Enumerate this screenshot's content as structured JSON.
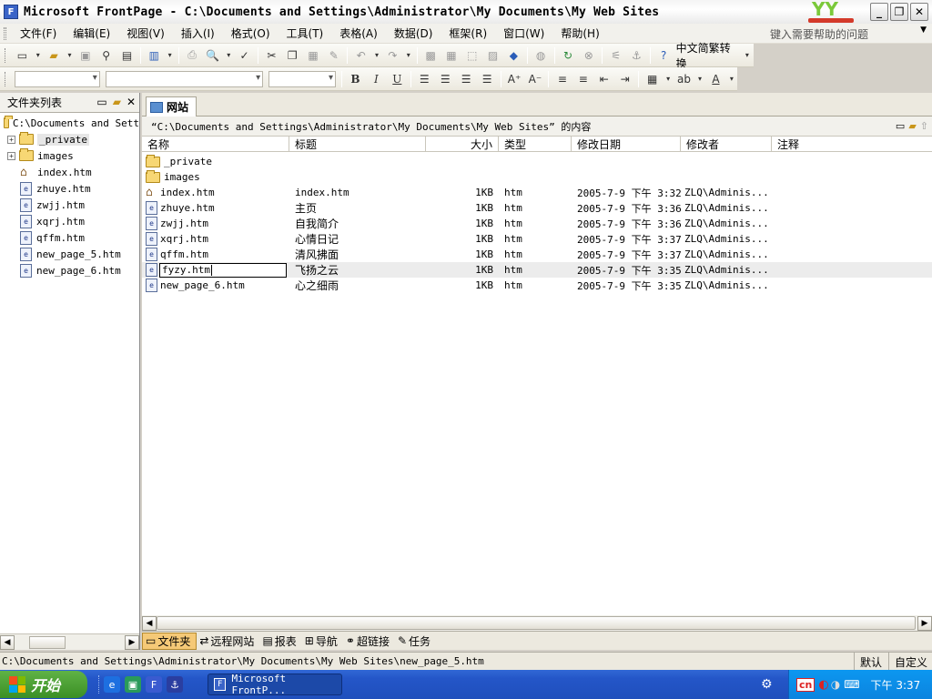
{
  "window": {
    "title": "Microsoft FrontPage - C:\\Documents and Settings\\Administrator\\My Documents\\My Web Sites",
    "controls": [
      "_",
      "❐",
      "✕"
    ],
    "logo_text": "YY"
  },
  "menu": [
    "文件(F)",
    "编辑(E)",
    "视图(V)",
    "插入(I)",
    "格式(O)",
    "工具(T)",
    "表格(A)",
    "数据(D)",
    "框架(R)",
    "窗口(W)",
    "帮助(H)"
  ],
  "help_box": {
    "placeholder": "键入需要帮助的问题"
  },
  "toolbar": {
    "convert_label": "中文简繁转换"
  },
  "folder_list": {
    "title": "文件夹列表",
    "root": "C:\\Documents and Sett",
    "items": [
      {
        "name": "_private",
        "type": "folder",
        "expandable": true,
        "selected": true
      },
      {
        "name": "images",
        "type": "folder",
        "expandable": true
      },
      {
        "name": "index.htm",
        "type": "home"
      },
      {
        "name": "zhuye.htm",
        "type": "page"
      },
      {
        "name": "zwjj.htm",
        "type": "page"
      },
      {
        "name": "xqrj.htm",
        "type": "page"
      },
      {
        "name": "qffm.htm",
        "type": "page"
      },
      {
        "name": "new_page_5.htm",
        "type": "page"
      },
      {
        "name": "new_page_6.htm",
        "type": "page"
      }
    ]
  },
  "tab": {
    "label": "网站"
  },
  "path_label": "“C:\\Documents and Settings\\Administrator\\My Documents\\My Web Sites” 的内容",
  "columns": [
    "名称",
    "标题",
    "大小",
    "类型",
    "修改日期",
    "修改者",
    "注释"
  ],
  "files": [
    {
      "name": "_private",
      "title": "",
      "size": "",
      "type": "",
      "date": "",
      "by": "",
      "kind": "folder"
    },
    {
      "name": "images",
      "title": "",
      "size": "",
      "type": "",
      "date": "",
      "by": "",
      "kind": "folder"
    },
    {
      "name": "index.htm",
      "title": "index.htm",
      "size": "1KB",
      "type": "htm",
      "date": "2005-7-9 下午 3:32",
      "by": "ZLQ\\Adminis...",
      "kind": "home"
    },
    {
      "name": "zhuye.htm",
      "title": "主页",
      "size": "1KB",
      "type": "htm",
      "date": "2005-7-9 下午 3:36",
      "by": "ZLQ\\Adminis...",
      "kind": "page"
    },
    {
      "name": "zwjj.htm",
      "title": "自我简介",
      "size": "1KB",
      "type": "htm",
      "date": "2005-7-9 下午 3:36",
      "by": "ZLQ\\Adminis...",
      "kind": "page"
    },
    {
      "name": "xqrj.htm",
      "title": "心情日记",
      "size": "1KB",
      "type": "htm",
      "date": "2005-7-9 下午 3:37",
      "by": "ZLQ\\Adminis...",
      "kind": "page"
    },
    {
      "name": "qffm.htm",
      "title": "清风拂面",
      "size": "1KB",
      "type": "htm",
      "date": "2005-7-9 下午 3:37",
      "by": "ZLQ\\Adminis...",
      "kind": "page"
    },
    {
      "name": "fyzy.htm",
      "title": "飞扬之云",
      "size": "1KB",
      "type": "htm",
      "date": "2005-7-9 下午 3:35",
      "by": "ZLQ\\Adminis...",
      "kind": "page",
      "editing": true
    },
    {
      "name": "new_page_6.htm",
      "title": "心之细雨",
      "size": "1KB",
      "type": "htm",
      "date": "2005-7-9 下午 3:35",
      "by": "ZLQ\\Adminis...",
      "kind": "page"
    }
  ],
  "view_tabs": [
    "文件夹",
    "远程网站",
    "报表",
    "导航",
    "超链接",
    "任务"
  ],
  "status": {
    "path": "C:\\Documents and Settings\\Administrator\\My Documents\\My Web Sites\\new_page_5.htm",
    "mode": "默认",
    "custom": "自定义"
  },
  "taskbar": {
    "start": "开始",
    "task": "Microsoft FrontP...",
    "ime": "cn",
    "clock": "下午 3:37"
  }
}
